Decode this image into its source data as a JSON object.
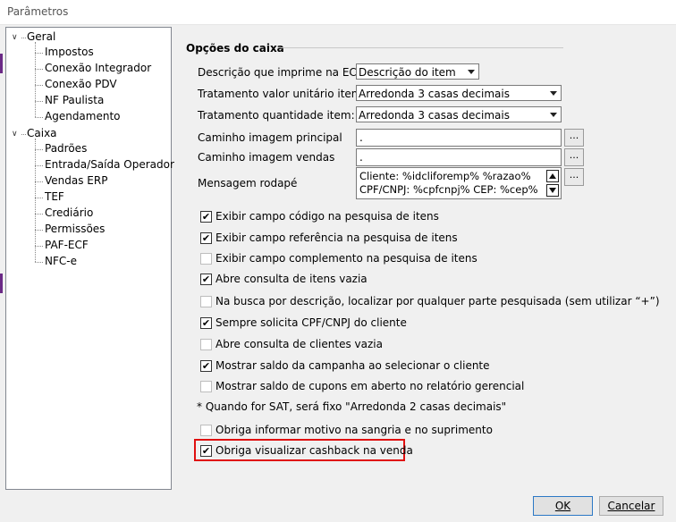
{
  "window": {
    "title": "Parâmetros"
  },
  "tree": {
    "groups": [
      {
        "label": "Geral",
        "children": [
          "Impostos",
          "Conexão Integrador",
          "Conexão PDV",
          "NF Paulista",
          "Agendamento"
        ]
      },
      {
        "label": "Caixa",
        "children": [
          "Padrões",
          "Entrada/Saída Operador",
          "Vendas ERP",
          "TEF",
          "Crediário",
          "Permissões",
          "PAF-ECF",
          "NFC-e"
        ]
      }
    ]
  },
  "section": {
    "title": "Opções do caixa"
  },
  "fields": {
    "descricao_ecf": {
      "label": "Descrição que imprime na ECF",
      "value": "Descrição do item"
    },
    "tratamento_valor": {
      "label": "Tratamento valor unitário item*",
      "value": "Arredonda 3 casas decimais"
    },
    "tratamento_qtd": {
      "label": "Tratamento quantidade item:",
      "value": "Arredonda 3 casas decimais"
    },
    "img_principal": {
      "label": "Caminho imagem principal",
      "value": ".",
      "button": "..."
    },
    "img_vendas": {
      "label": "Caminho imagem vendas",
      "value": ".",
      "button": "..."
    },
    "rodape": {
      "label": "Mensagem rodapé",
      "line1": "Cliente: %idcliforemp% %razao%",
      "line2": "CPF/CNPJ: %cpfcnpj% CEP: %cep%",
      "button": "..."
    }
  },
  "checkboxes": [
    {
      "label": "Exibir campo código na pesquisa de itens",
      "checked": true
    },
    {
      "label": "Exibir campo referência na pesquisa de itens",
      "checked": true
    },
    {
      "label": "Exibir campo complemento na pesquisa de itens",
      "checked": false
    },
    {
      "label": "Abre consulta de itens vazia",
      "checked": true
    },
    {
      "label": "Na busca por descrição, localizar por qualquer parte pesquisada (sem utilizar “+”)",
      "checked": false
    },
    {
      "label": "Sempre solicita CPF/CNPJ do cliente",
      "checked": true
    },
    {
      "label": "Abre consulta de clientes vazia",
      "checked": false
    },
    {
      "label": "Mostrar saldo da campanha ao selecionar o cliente",
      "checked": true
    },
    {
      "label": "Mostrar saldo de cupons em aberto no relatório gerencial",
      "checked": false
    }
  ],
  "note": "* Quando for SAT, será fixo \"Arredonda 2 casas decimais\"",
  "checkboxes2": [
    {
      "label": "Obriga informar motivo na sangria e no suprimento",
      "checked": false
    },
    {
      "label": "Obriga visualizar cashback na venda",
      "checked": true
    }
  ],
  "check_mark": "✔",
  "buttons": {
    "ok": "OK",
    "cancel": "Cancelar"
  },
  "colors": {
    "highlight": "#e01010",
    "purple_edge": "#6b2a86"
  }
}
